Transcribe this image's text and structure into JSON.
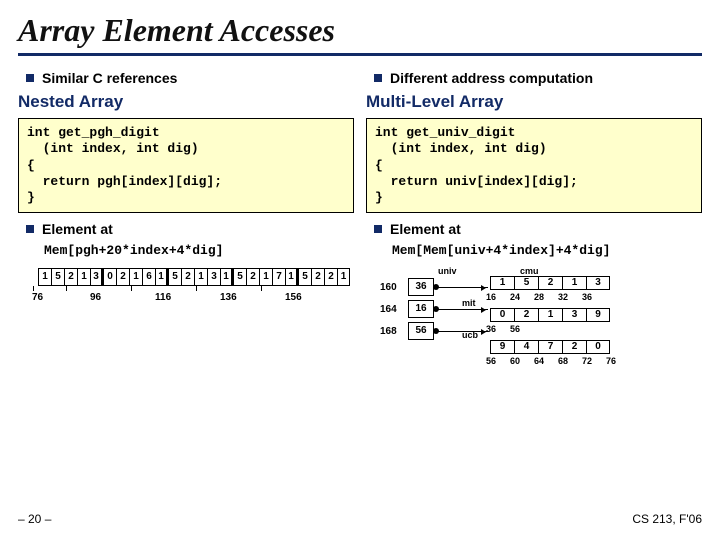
{
  "title": "Array Element Accesses",
  "left": {
    "bullet1": "Similar C references",
    "section": "Nested Array",
    "code": "int get_pgh_digit\n  (int index, int dig)\n{\n  return pgh[index][dig];\n}",
    "element_label": "Element at",
    "mem": "Mem[pgh+20*index+4*dig]"
  },
  "right": {
    "bullet1": "Different address computation",
    "section": "Multi-Level Array",
    "code": "int get_univ_digit\n  (int index, int dig)\n{\n  return univ[index][dig];\n}",
    "element_label": "Element at",
    "mem": "Mem[Mem[univ+4*index]+4*dig]"
  },
  "dia1": {
    "cells": [
      "1",
      "5",
      "2",
      "1",
      "3",
      "0",
      "2",
      "1",
      "6",
      "1",
      "5",
      "2",
      "1",
      "3",
      "1",
      "5",
      "2",
      "1",
      "7",
      "1",
      "5",
      "2",
      "2",
      "1"
    ],
    "ticks": [
      "76",
      "96",
      "116",
      "136",
      "156"
    ]
  },
  "dia2": {
    "hdr_cmu": "cmu",
    "hdr_mit": "mit",
    "hdr_ucb": "ucb",
    "hdr_univ": "univ",
    "box_labels": [
      "160",
      "164",
      "168"
    ],
    "box_vals": [
      "36",
      "16",
      "56"
    ],
    "row0": [
      "1",
      "5",
      "2",
      "1",
      "3"
    ],
    "row0_addr": [
      "16",
      "24",
      "28",
      "32",
      "36"
    ],
    "row1": [
      "0",
      "2",
      "1",
      "3",
      "9"
    ],
    "row1_addr": [
      "36",
      "56"
    ],
    "row2": [
      "9",
      "4",
      "7",
      "2",
      "0"
    ],
    "row2_addr": [
      "56",
      "60",
      "64",
      "68",
      "72",
      "76"
    ]
  },
  "footer": {
    "left": "– 20 –",
    "right": "CS 213, F'06"
  }
}
